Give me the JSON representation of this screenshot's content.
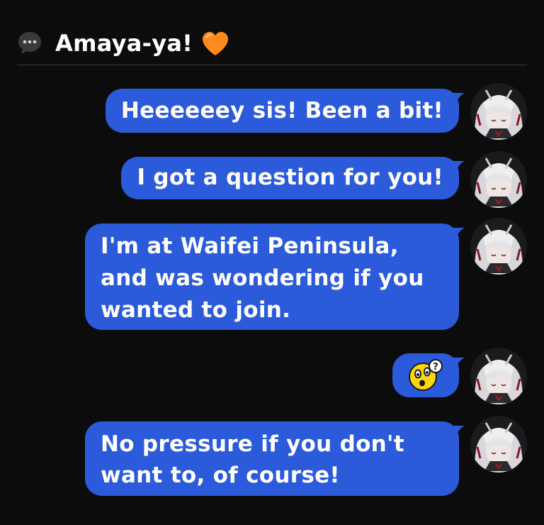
{
  "header": {
    "title": "Amaya-ya!",
    "chat_icon": "speech-bubble-icon",
    "heart_icon": "orange-heart-icon"
  },
  "colors": {
    "background": "#0c0c0c",
    "bubble": "#2b5ada",
    "text": "#ffffff",
    "heart": "#ff8a1d",
    "emoji": "#ffd60a"
  },
  "messages": [
    {
      "text": "Heeeeeey sis! Been a bit!"
    },
    {
      "text": "I got a question for you!"
    },
    {
      "lines": [
        "I'm at Waifei Peninsula,",
        "and was wondering if you",
        "wanted to join."
      ]
    },
    {
      "emoji": "confused-face-with-question-mark-emoji"
    },
    {
      "lines": [
        "No pressure if you don't",
        "want to, of course!"
      ]
    }
  ]
}
